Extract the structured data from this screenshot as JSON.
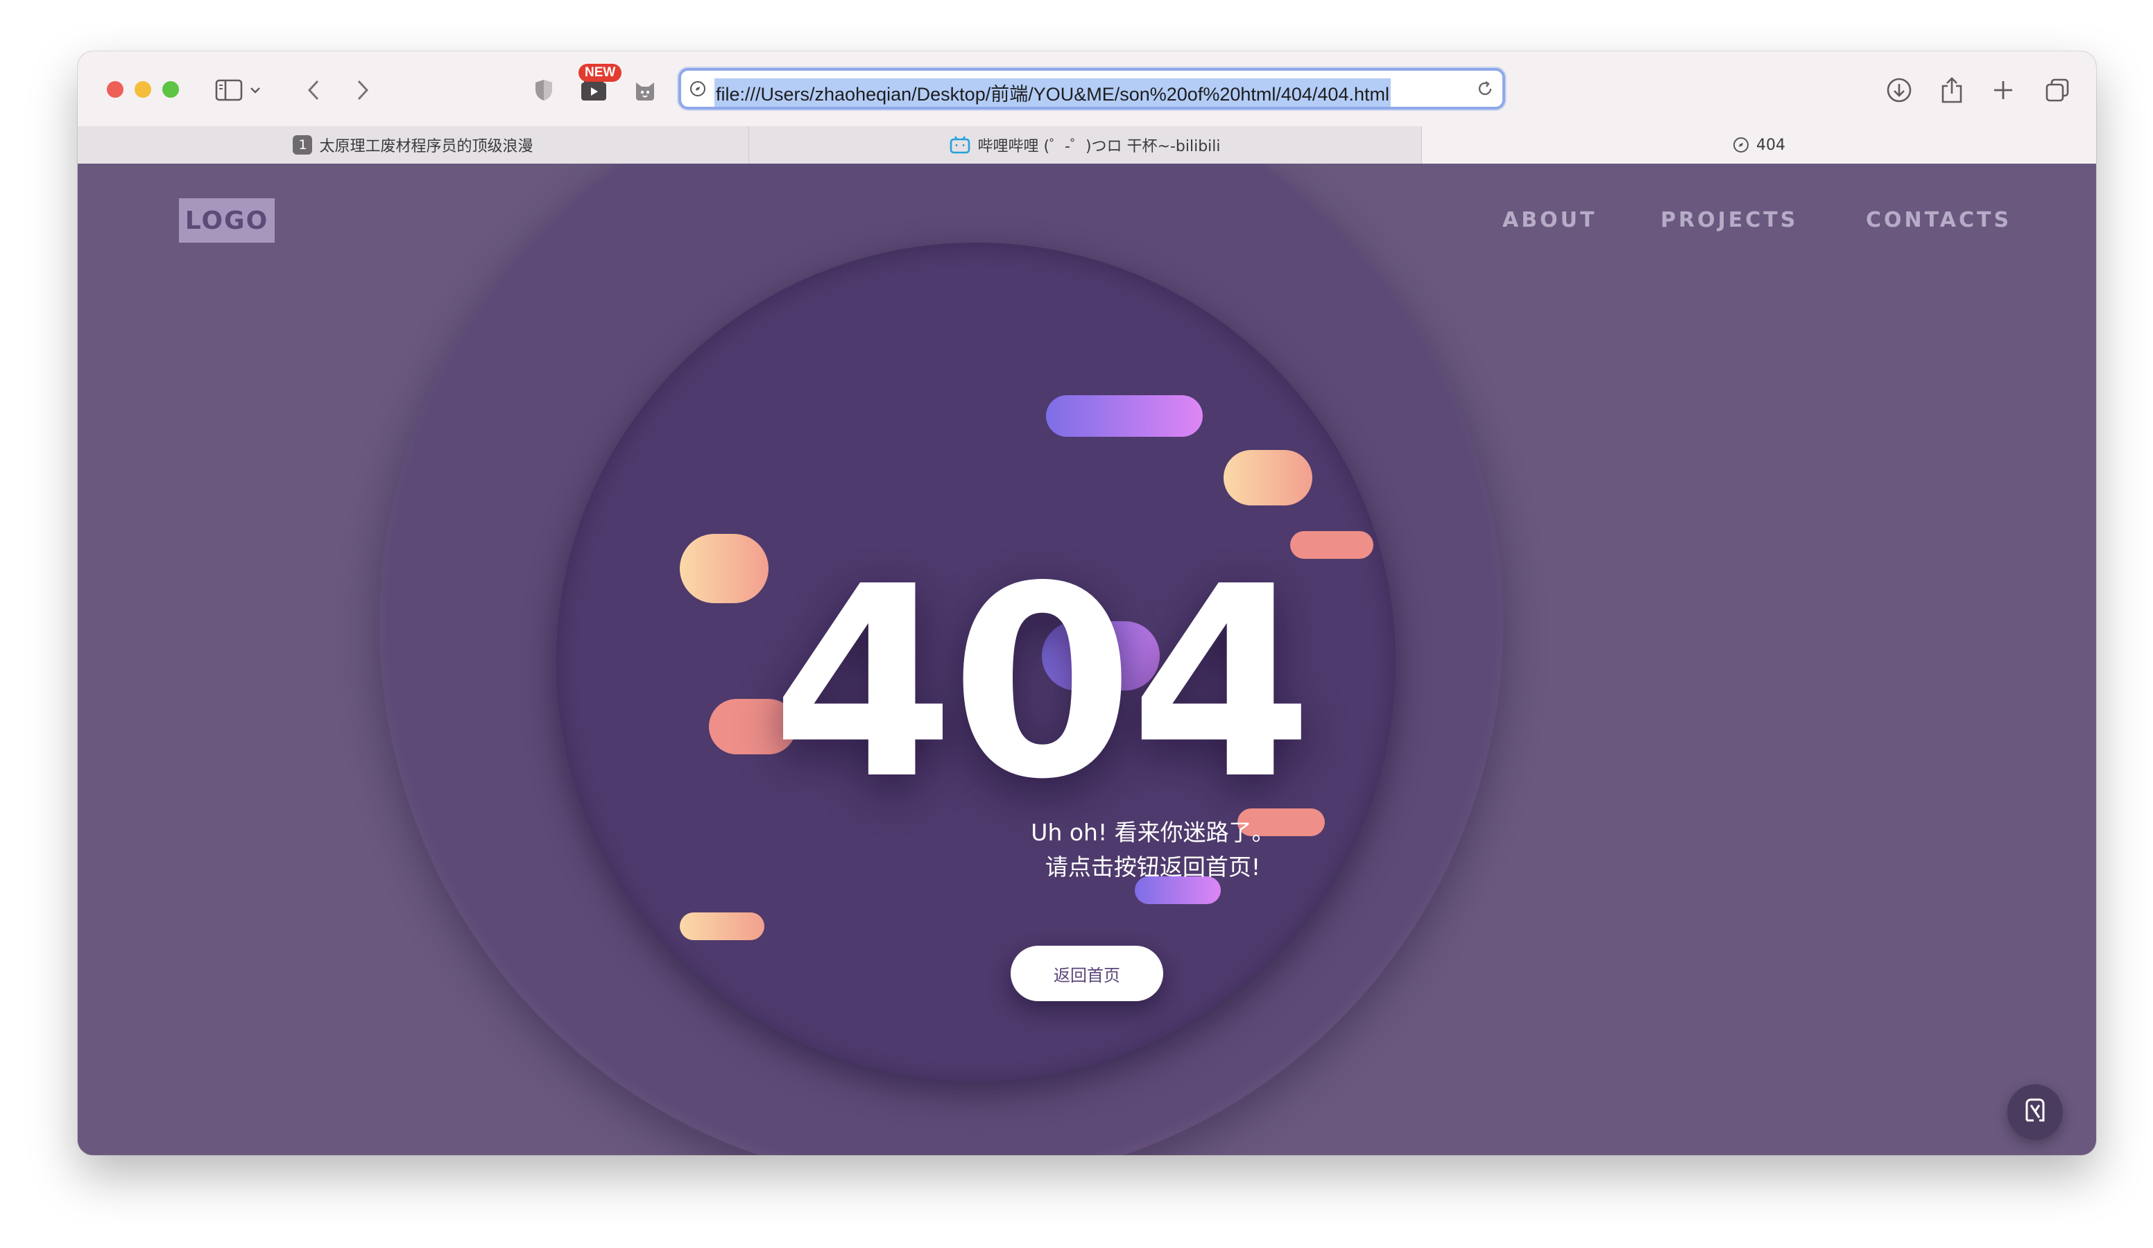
{
  "browser": {
    "address_url": "file:///Users/zhaoheqian/Desktop/前端/YOU&ME/son%20of%20html/404/404.html",
    "new_badge": "NEW",
    "tabs": [
      {
        "favicon_text": "1",
        "label": "太原理工废材程序员的顶级浪漫",
        "active": false
      },
      {
        "label": "哔哩哔哩 (゜-゜)つロ 干杯~-bilibili",
        "active": false
      },
      {
        "label": "404",
        "active": true
      }
    ],
    "icons": {
      "sidebar": "sidebar-icon",
      "back": "chevron-left-icon",
      "forward": "chevron-right-icon",
      "privacy": "shield-icon",
      "downloads": "download-icon",
      "share": "share-icon",
      "new_tab": "plus-icon",
      "tabs_overview": "tabs-overview-icon"
    }
  },
  "page": {
    "logo": "LOGO",
    "nav": [
      "ABOUT",
      "PROJECTS",
      "CONTACTS"
    ],
    "error_code": "404",
    "message_line1": "Uh oh! 看来你迷路了。",
    "message_line2": "请点击按钮返回首页!",
    "home_button": "返回首页",
    "colors": {
      "background": "#6a587f",
      "outer_circle": "#5e4a76",
      "inner_circle": "#4e3a6c",
      "coral": "#ee8f89",
      "peach_from": "#fbd9a8",
      "peach_to": "#f2a08f",
      "purple_from": "#7d6ee6",
      "purple_to": "#de86f5"
    }
  }
}
